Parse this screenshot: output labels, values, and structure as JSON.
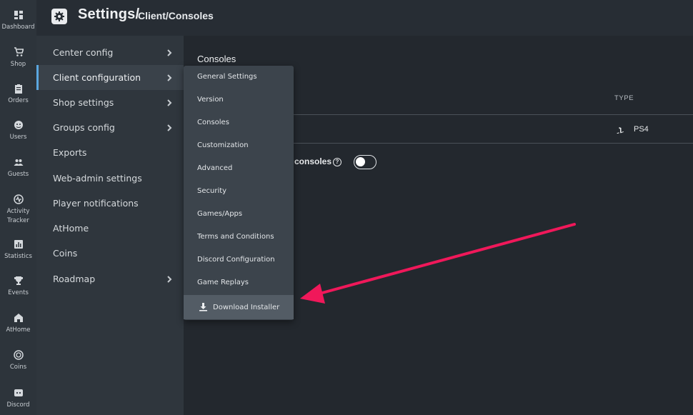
{
  "rail": {
    "items": [
      {
        "label": "Dashboard",
        "icon": "dashboard-icon"
      },
      {
        "label": "Shop",
        "icon": "cart-icon"
      },
      {
        "label": "Orders",
        "icon": "clipboard-icon"
      },
      {
        "label": "Users",
        "icon": "users-icon"
      },
      {
        "label": "Guests",
        "icon": "guests-icon"
      },
      {
        "label": "Activity Tracker",
        "icon": "activity-icon"
      },
      {
        "label": "Statistics",
        "icon": "statistics-icon"
      },
      {
        "label": "Events",
        "icon": "trophy-icon"
      },
      {
        "label": "AtHome",
        "icon": "home-icon"
      },
      {
        "label": "Coins",
        "icon": "coins-icon"
      },
      {
        "label": "Discord",
        "icon": "discord-icon"
      }
    ]
  },
  "header": {
    "title": "Settings/",
    "subtitle": "Client/Consoles",
    "icon": "gear-icon"
  },
  "menu": {
    "items": [
      {
        "label": "Center config",
        "has_children": true
      },
      {
        "label": "Client configuration",
        "has_children": true,
        "active": true
      },
      {
        "label": "Shop settings",
        "has_children": true
      },
      {
        "label": "Groups config",
        "has_children": true
      },
      {
        "label": "Exports",
        "has_children": false
      },
      {
        "label": "Web-admin settings",
        "has_children": false
      },
      {
        "label": "Player notifications",
        "has_children": false
      },
      {
        "label": "AtHome",
        "has_children": false
      },
      {
        "label": "Coins",
        "has_children": false
      },
      {
        "label": "Roadmap",
        "has_children": true
      }
    ]
  },
  "dropdown": {
    "items": [
      "General Settings",
      "Version",
      "Consoles",
      "Customization",
      "Advanced",
      "Security",
      "Games/Apps",
      "Terms and Conditions",
      "Discord Configuration",
      "Game Replays"
    ],
    "download_label": "Download Installer"
  },
  "content": {
    "section_title": "Consoles",
    "table": {
      "type_header": "TYPE",
      "rows": [
        {
          "type": "PS4",
          "icon": "playstation-icon"
        }
      ]
    },
    "toggle_label": "consoles",
    "toggle_on": false
  },
  "colors": {
    "accent": "#5ba7e0",
    "annotation_arrow": "#f0185a"
  }
}
